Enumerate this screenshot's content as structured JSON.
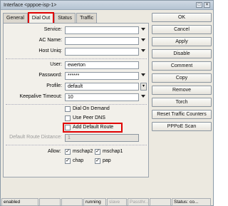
{
  "window": {
    "title": "Interface <pppoe-isp-1>"
  },
  "tabs": [
    {
      "label": "General"
    },
    {
      "label": "Dial Out"
    },
    {
      "label": "Status"
    },
    {
      "label": "Traffic"
    }
  ],
  "fields": {
    "service": {
      "label": "Service:",
      "value": ""
    },
    "ac_name": {
      "label": "AC Name:",
      "value": ""
    },
    "host_uniq": {
      "label": "Host Uniq:",
      "value": ""
    },
    "user": {
      "label": "User:",
      "value": "ewerton"
    },
    "password": {
      "label": "Password:",
      "value": "******"
    },
    "profile": {
      "label": "Profile:",
      "value": "default"
    },
    "keepalive": {
      "label": "Keepalive Timeout:",
      "value": "10"
    },
    "default_route_distance": {
      "label": "Default Route Distance:",
      "value": "1"
    }
  },
  "options": {
    "dial_on_demand": {
      "label": "Dial On Demand",
      "checked": false
    },
    "use_peer_dns": {
      "label": "Use Peer DNS",
      "checked": false
    },
    "add_default_route": {
      "label": "Add Default Route",
      "checked": false
    }
  },
  "allow": {
    "label": "Allow:",
    "mschap2": {
      "label": "mschap2",
      "checked": true
    },
    "mschap1": {
      "label": "mschap1",
      "checked": true
    },
    "chap": {
      "label": "chap",
      "checked": true
    },
    "pap": {
      "label": "pap",
      "checked": true
    }
  },
  "buttons": {
    "ok": "OK",
    "cancel": "Cancel",
    "apply": "Apply",
    "disable": "Disable",
    "comment": "Comment",
    "copy": "Copy",
    "remove": "Remove",
    "torch": "Torch",
    "reset_traffic": "Reset Traffic Counters",
    "pppoe_scan": "PPPoE Scan"
  },
  "statusbar": {
    "enabled": "enabled",
    "running": "running",
    "slave": "slave",
    "passthrough": "Passthr...",
    "status": "Status: co..."
  },
  "colors": {
    "highlight": "#e00000",
    "window_bg": "#ece9e0"
  }
}
